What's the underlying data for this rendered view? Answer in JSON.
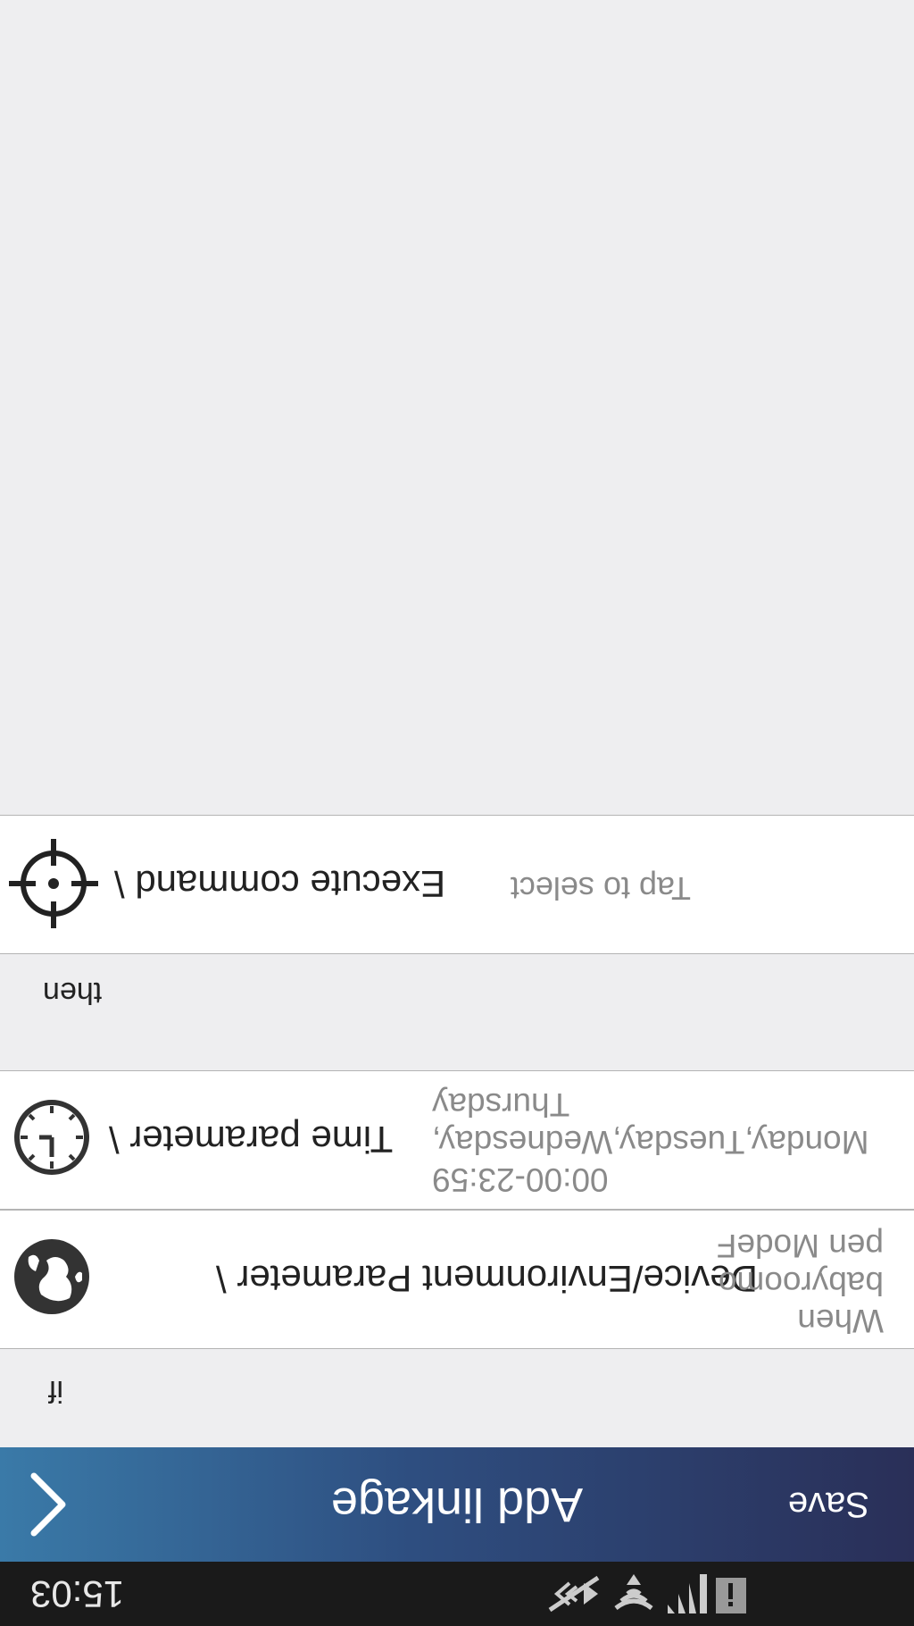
{
  "status_bar": {
    "time": "15:03",
    "icons": [
      "info-icon",
      "signal-icon",
      "wifi-icon",
      "mute-icon"
    ]
  },
  "nav": {
    "back_icon": "chevron-left-icon",
    "title": "Add linkage",
    "save_label": "Save",
    "gradient": [
      "#2a2f58",
      "#3a7aa8"
    ]
  },
  "if_section": {
    "label": "if",
    "rows": [
      {
        "icon": "globe-icon",
        "title": "Device/Environment Parameter \\",
        "detail": "When babyroomo pen ModeF"
      },
      {
        "icon": "clock-icon",
        "title": "Time parameter \\",
        "detail_line1": "00:00-23:59",
        "detail_line2": "Monday,Tuesday,Wednesday,",
        "detail_line3": "Thursday"
      }
    ]
  },
  "then_section": {
    "label": "then",
    "row": {
      "icon": "crosshair-icon",
      "title": "Execute command \\",
      "detail": "Tap to select"
    }
  }
}
